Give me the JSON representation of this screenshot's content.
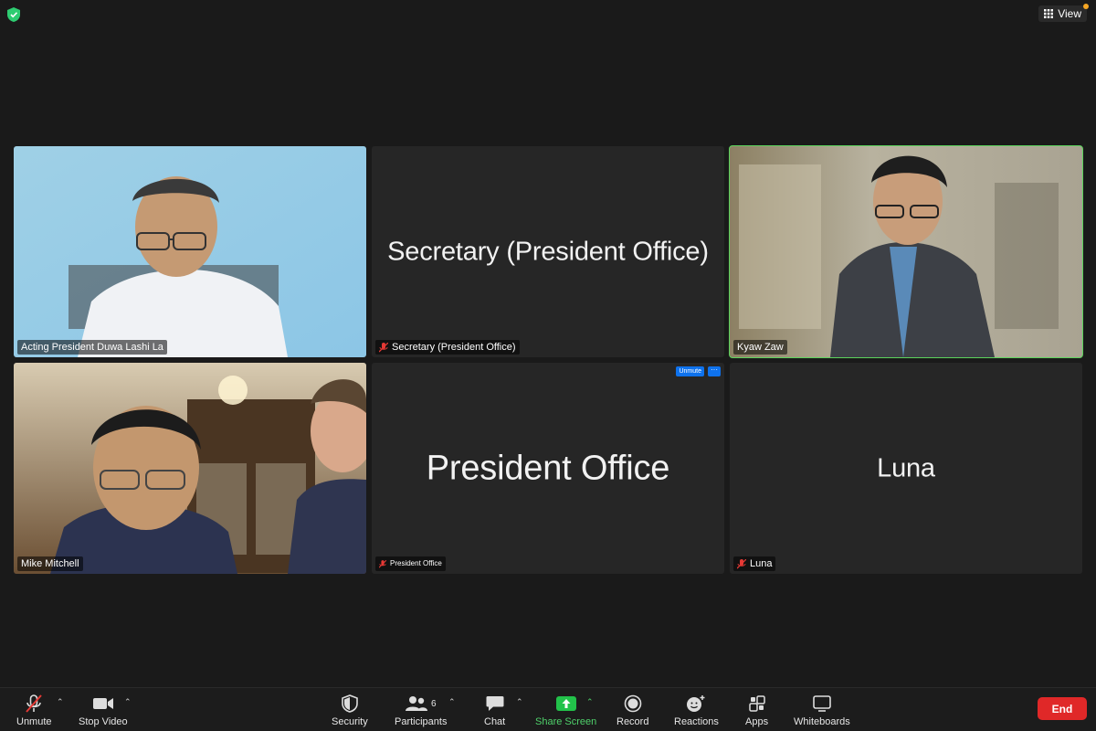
{
  "top": {
    "view_label": "View"
  },
  "tiles": [
    {
      "name": "Acting President Duwa Lashi La"
    },
    {
      "name": "Secretary (President Office)",
      "label": "Secretary (President Office)"
    },
    {
      "name": "Kyaw Zaw"
    },
    {
      "name": "Mike Mitchell"
    },
    {
      "name": "President Office",
      "label": "President Office",
      "unmute": "Unmute",
      "more": "···"
    },
    {
      "name": "Luna",
      "label": "Luna"
    }
  ],
  "toolbar": {
    "unmute": "Unmute",
    "stop_video": "Stop Video",
    "security": "Security",
    "participants": "Participants",
    "participants_count": "6",
    "chat": "Chat",
    "share_screen": "Share Screen",
    "record": "Record",
    "reactions": "Reactions",
    "apps": "Apps",
    "whiteboards": "Whiteboards",
    "end": "End"
  },
  "colors": {
    "share_green": "#22c24a",
    "end_red": "#e02828",
    "active_speaker": "#5bd35b",
    "chip_blue": "#0e72ed"
  }
}
